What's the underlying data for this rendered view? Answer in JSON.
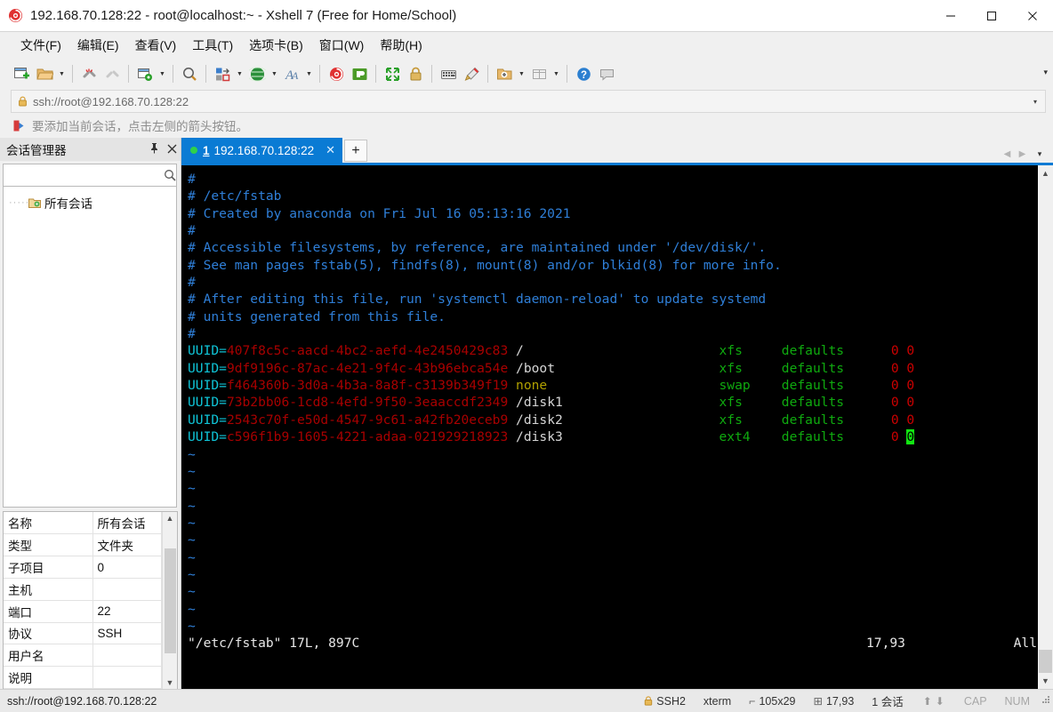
{
  "window": {
    "title": "192.168.70.128:22 - root@localhost:~ - Xshell 7 (Free for Home/School)",
    "minimize": "—",
    "maximize": "□",
    "close": "✕"
  },
  "menu": {
    "items": [
      {
        "label": "文件(F)",
        "name": "menu-file"
      },
      {
        "label": "编辑(E)",
        "name": "menu-edit"
      },
      {
        "label": "查看(V)",
        "name": "menu-view"
      },
      {
        "label": "工具(T)",
        "name": "menu-tools"
      },
      {
        "label": "选项卡(B)",
        "name": "menu-tabs"
      },
      {
        "label": "窗口(W)",
        "name": "menu-window"
      },
      {
        "label": "帮助(H)",
        "name": "menu-help"
      }
    ]
  },
  "toolbar": {
    "overflow": "▾",
    "icons": [
      "new-session-icon",
      "open-folder-icon",
      "disconnect-icon",
      "reconnect-icon",
      "session-properties-icon",
      "find-icon",
      "transfer-icon",
      "globe-icon",
      "font-icon",
      "xshell-icon",
      "xftp-icon",
      "fullscreen-icon",
      "lock-icon",
      "keyboard-icon",
      "highlight-icon",
      "new-folder-icon",
      "layout-icon",
      "help-icon",
      "comment-icon"
    ]
  },
  "address": {
    "value": "ssh://root@192.168.70.128:22",
    "caret": "▾"
  },
  "hint": {
    "text": "要添加当前会话，点击左侧的箭头按钮。"
  },
  "sidebar": {
    "title": "会话管理器",
    "pin": "📌",
    "close": "✕",
    "search_placeholder": "",
    "search_value": "",
    "tree": [
      {
        "label": "所有会话",
        "name": "tree-item-all-sessions"
      }
    ],
    "properties": [
      {
        "key": "名称",
        "value": "所有会话"
      },
      {
        "key": "类型",
        "value": "文件夹"
      },
      {
        "key": "子项目",
        "value": "0"
      },
      {
        "key": "主机",
        "value": ""
      },
      {
        "key": "端口",
        "value": "22"
      },
      {
        "key": "协议",
        "value": "SSH"
      },
      {
        "key": "用户名",
        "value": ""
      },
      {
        "key": "说明",
        "value": ""
      }
    ]
  },
  "tabs": {
    "active": {
      "number": "1",
      "label": "192.168.70.128:22",
      "close": "✕"
    },
    "add": "+",
    "nav_prev": "◀",
    "nav_next": "▶",
    "nav_menu": "▾"
  },
  "terminal": {
    "comments": [
      "#",
      "# /etc/fstab",
      "# Created by anaconda on Fri Jul 16 05:13:16 2021",
      "#",
      "# Accessible filesystems, by reference, are maintained under '/dev/disk/'.",
      "# See man pages fstab(5), findfs(8), mount(8) and/or blkid(8) for more info.",
      "#",
      "# After editing this file, run 'systemctl daemon-reload' to update systemd",
      "# units generated from this file.",
      "#"
    ],
    "fstab": [
      {
        "prefix": "UUID=",
        "uuid": "407f8c5c-aacd-4bc2-aefd-4e2450429c83",
        "mount": "/",
        "mount_kind": "path",
        "fs": "xfs",
        "opts": "defaults",
        "dump": "0",
        "pass": "0",
        "cursor": false
      },
      {
        "prefix": "UUID=",
        "uuid": "9df9196c-87ac-4e21-9f4c-43b96ebca54e",
        "mount": "/boot",
        "mount_kind": "path",
        "fs": "xfs",
        "opts": "defaults",
        "dump": "0",
        "pass": "0",
        "cursor": false
      },
      {
        "prefix": "UUID=",
        "uuid": "f464360b-3d0a-4b3a-8a8f-c3139b349f19",
        "mount": "none",
        "mount_kind": "none",
        "fs": "swap",
        "opts": "defaults",
        "dump": "0",
        "pass": "0",
        "cursor": false
      },
      {
        "prefix": "UUID=",
        "uuid": "73b2bb06-1cd8-4efd-9f50-3eaaccdf2349",
        "mount": "/disk1",
        "mount_kind": "path",
        "fs": "xfs",
        "opts": "defaults",
        "dump": "0",
        "pass": "0",
        "cursor": false
      },
      {
        "prefix": "UUID=",
        "uuid": "2543c70f-e50d-4547-9c61-a42fb20eceb9",
        "mount": "/disk2",
        "mount_kind": "path",
        "fs": "xfs",
        "opts": "defaults",
        "dump": "0",
        "pass": "0",
        "cursor": false
      },
      {
        "prefix": "UUID=",
        "uuid": "c596f1b9-1605-4221-adaa-021929218923",
        "mount": "/disk3",
        "mount_kind": "path",
        "fs": "ext4",
        "opts": "defaults",
        "dump": "0",
        "pass": "0",
        "cursor": true
      }
    ],
    "tilde_count": 11,
    "tilde": "~",
    "status": {
      "file": "\"/etc/fstab\" 17L, 897C",
      "position": "17,93",
      "scroll": "All"
    }
  },
  "statusbar": {
    "url": "ssh://root@192.168.70.128:22",
    "protocol": "SSH2",
    "emulation": "xterm",
    "size": "105x29",
    "position": "17,93",
    "sessions": "1 会话",
    "caps": "CAP",
    "num": "NUM",
    "arrow_up": "⬆",
    "arrow_down": "⬇"
  },
  "colors": {
    "accent": "#0a7bd4",
    "terminal_bg": "#000000",
    "comment": "#2f7fd8",
    "uuid_key": "#0fc5d8",
    "uuid_value": "#a80000",
    "fs_type": "#0faa0f",
    "numbers": "#cc0000",
    "cursor": "#12e612"
  }
}
